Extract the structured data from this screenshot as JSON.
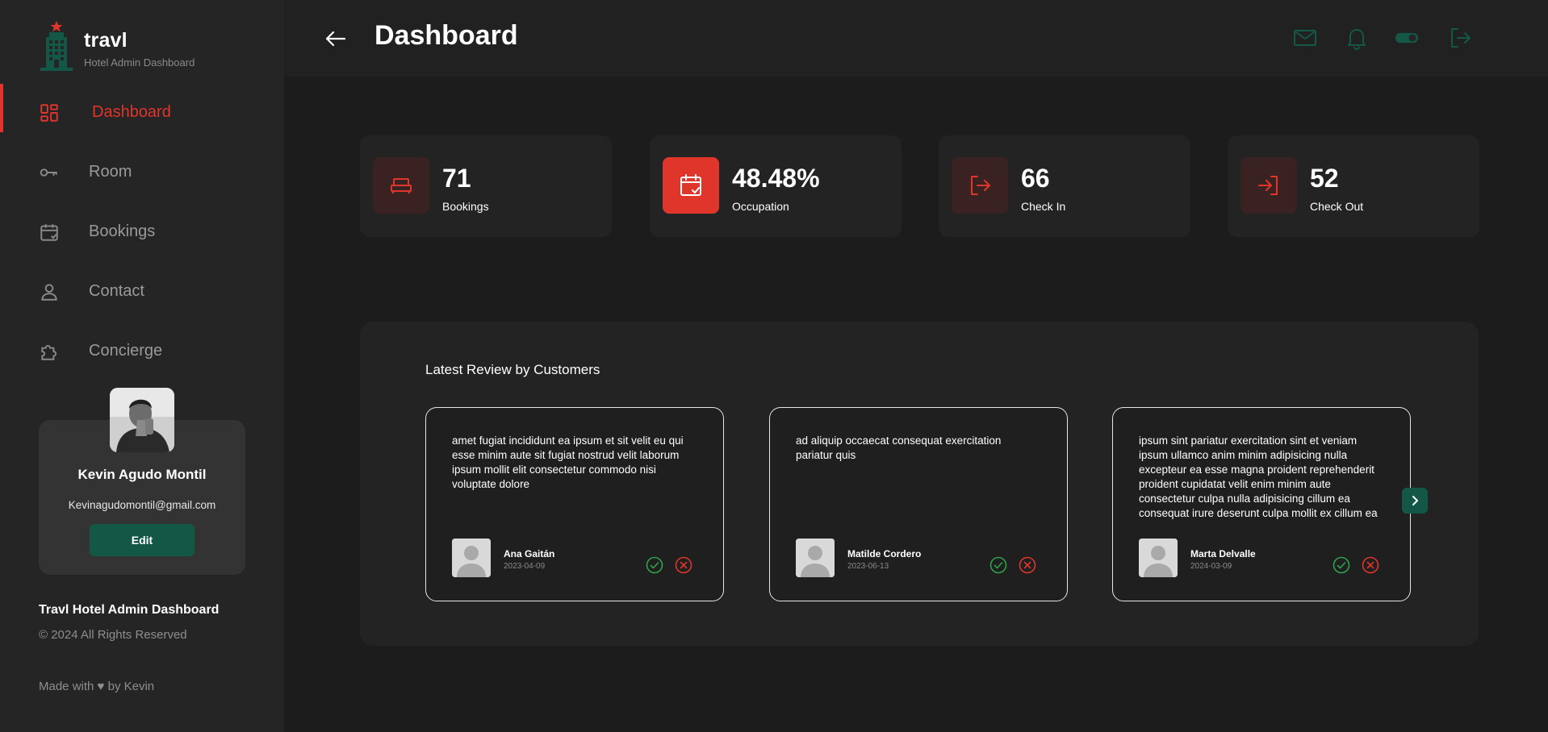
{
  "brand": {
    "name": "travl",
    "subtitle": "Hotel Admin Dashboard",
    "logo_icon": "hotel-building-icon",
    "logo_color": "#135846",
    "logo_star_color": "#e0352b"
  },
  "sidebar": {
    "items": [
      {
        "label": "Dashboard",
        "icon": "dashboard-grid-icon",
        "active": true
      },
      {
        "label": "Room",
        "icon": "key-icon",
        "active": false
      },
      {
        "label": "Bookings",
        "icon": "calendar-check-icon",
        "active": false
      },
      {
        "label": "Contact",
        "icon": "user-icon",
        "active": false
      },
      {
        "label": "Concierge",
        "icon": "puzzle-icon",
        "active": false
      }
    ]
  },
  "profile": {
    "name": "Kevin Agudo Montil",
    "email": "Kevinagudomontil@gmail.com",
    "edit_label": "Edit"
  },
  "footer": {
    "title": "Travl Hotel Admin Dashboard",
    "copyright": "© 2024 All Rights Reserved",
    "made_with": "Made with ♥ by Kevin"
  },
  "header": {
    "title": "Dashboard",
    "back_icon": "arrow-left-icon",
    "icons": [
      "mail-icon",
      "bell-icon",
      "toggle-icon",
      "logout-icon"
    ]
  },
  "stats": [
    {
      "value": "71",
      "label": "Bookings",
      "icon": "bed-icon",
      "highlight": false
    },
    {
      "value": "48.48%",
      "label": "Occupation",
      "icon": "calendar-check-icon",
      "highlight": true
    },
    {
      "value": "66",
      "label": "Check In",
      "icon": "login-icon",
      "highlight": false
    },
    {
      "value": "52",
      "label": "Check Out",
      "icon": "logout-icon",
      "highlight": false
    }
  ],
  "reviews": {
    "title": "Latest Review by Customers",
    "items": [
      {
        "text": "amet fugiat incididunt ea ipsum et sit velit eu qui esse minim aute sit fugiat nostrud velit laborum ipsum mollit elit consectetur commodo nisi voluptate dolore",
        "name": "Ana Gaitán",
        "date": "2023-04-09"
      },
      {
        "text": "ad aliquip occaecat consequat exercitation pariatur quis",
        "name": "Matilde Cordero",
        "date": "2023-06-13"
      },
      {
        "text": "ipsum sint pariatur exercitation sint et veniam ipsum ullamco anim minim adipisicing nulla excepteur ea esse magna proident reprehenderit proident cupidatat velit enim minim aute consectetur culpa nulla adipisicing cillum ea consequat irure deserunt culpa mollit ex cillum ea",
        "name": "Marta Delvalle",
        "date": "2024-03-09"
      }
    ]
  },
  "colors": {
    "accent_red": "#e0352b",
    "accent_green": "#135846",
    "approve_green": "#2fa24a",
    "reject_red": "#e0352b"
  }
}
